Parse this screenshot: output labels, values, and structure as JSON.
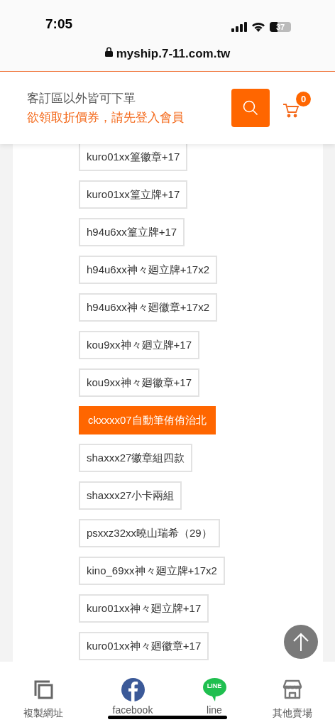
{
  "status_bar": {
    "time": "7:05",
    "battery": "37"
  },
  "url_bar": {
    "url": "myship.7-11.com.tw"
  },
  "header": {
    "notice": "客訂區以外皆可下單",
    "login_prompt": "欲領取折價券，請先登入會員",
    "cart_count": "0"
  },
  "options": [
    {
      "label": "kuro01xx篁徽章+17",
      "selected": false
    },
    {
      "label": "kuro01xx篁立牌+17",
      "selected": false
    },
    {
      "label": "h94u6xx篁立牌+17",
      "selected": false
    },
    {
      "label": "h94u6xx神々廻立牌+17x2",
      "selected": false
    },
    {
      "label": "h94u6xx神々廻徽章+17x2",
      "selected": false
    },
    {
      "label": "kou9xx神々廻立牌+17",
      "selected": false
    },
    {
      "label": "kou9xx神々廻徽章+17",
      "selected": false
    },
    {
      "label": "ckxxxx07自動筆侑侑治北",
      "selected": true
    },
    {
      "label": "shaxxx27徽章組四款",
      "selected": false
    },
    {
      "label": "shaxxx27小卡兩組",
      "selected": false
    },
    {
      "label": "psxxz32xx曉山瑞希（29）",
      "selected": false
    },
    {
      "label": "kino_69xx神々廻立牌+17x2",
      "selected": false
    },
    {
      "label": "kuro01xx神々廻立牌+17",
      "selected": false
    },
    {
      "label": "kuro01xx神々廻徽章+17",
      "selected": false
    }
  ],
  "bottom_nav": [
    {
      "kind": "copy",
      "label": "複製網址"
    },
    {
      "kind": "facebook",
      "label": "facebook"
    },
    {
      "kind": "line",
      "label": "line",
      "logo_text": "LINE"
    },
    {
      "kind": "store",
      "label": "其他賣場"
    }
  ]
}
